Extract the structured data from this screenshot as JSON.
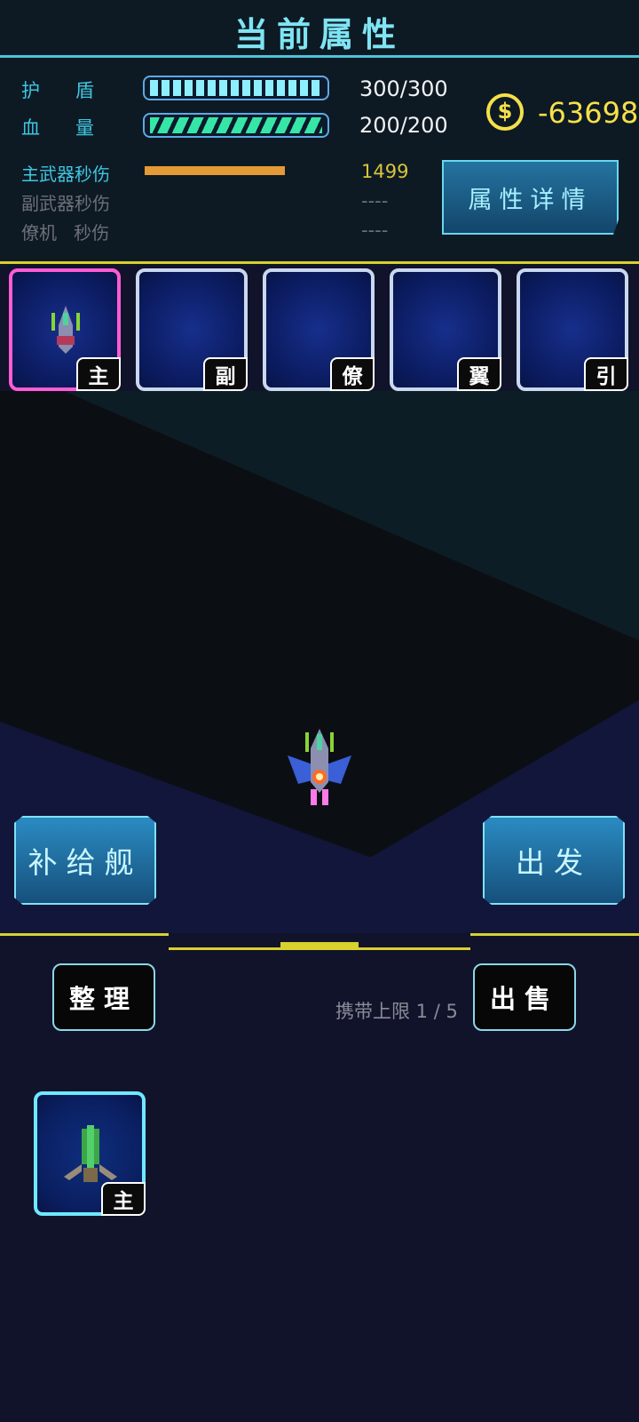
{
  "title": "当前属性",
  "stats": {
    "shield_label": "护      盾",
    "shield_value": "300/300",
    "shield_fraction": 1.0,
    "hp_label": "血      量",
    "hp_value": "200/200",
    "hp_fraction": 1.0
  },
  "currency": {
    "icon": "coin-icon",
    "value": "-63698",
    "color": "#f4e04a"
  },
  "dps": {
    "main_label": "主武器秒伤",
    "main_value": "1499",
    "main_bar_fraction": 0.76,
    "sub_label": "副武器秒伤",
    "sub_value": "----",
    "wing_label": "僚机   秒伤",
    "wing_value": "----"
  },
  "detail_button": "属性详情",
  "slots": [
    {
      "tag": "主",
      "active": true
    },
    {
      "tag": "副",
      "active": false
    },
    {
      "tag": "僚",
      "active": false
    },
    {
      "tag": "翼",
      "active": false
    },
    {
      "tag": "引",
      "active": false
    }
  ],
  "buttons": {
    "supply": "补给舰",
    "depart": "出发",
    "organize": "整理",
    "sell": "出售"
  },
  "carry_limit": "携带上限 1 / 5",
  "inventory": [
    {
      "tag": "主"
    }
  ],
  "colors": {
    "accent": "#7fe4f3",
    "gold": "#f4e04a",
    "active_border": "#ff5cd6"
  }
}
